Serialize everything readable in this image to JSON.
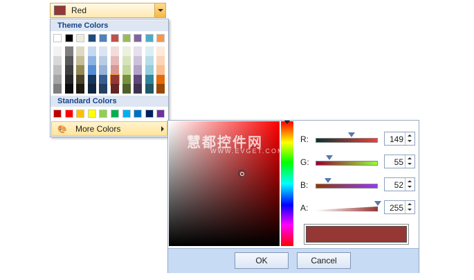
{
  "combo": {
    "selected_label": "Red",
    "selected_color": "#953734"
  },
  "palette": {
    "theme_title": "Theme Colors",
    "theme_top": [
      "#ffffff",
      "#000000",
      "#eeece1",
      "#1f497d",
      "#4f81bd",
      "#c0504d",
      "#9bbb59",
      "#8064a2",
      "#4bacc6",
      "#f79646"
    ],
    "theme_shades": [
      [
        "#f2f2f2",
        "#d8d8d8",
        "#bfbfbf",
        "#a5a5a5",
        "#7f7f7f"
      ],
      [
        "#7f7f7f",
        "#595959",
        "#3f3f3f",
        "#262626",
        "#0c0c0c"
      ],
      [
        "#ddd9c3",
        "#c4bd97",
        "#938953",
        "#494429",
        "#1d1b10"
      ],
      [
        "#c6d9f0",
        "#8db3e2",
        "#548dd4",
        "#17365d",
        "#0f243e"
      ],
      [
        "#dbe5f1",
        "#b8cce4",
        "#95b3d7",
        "#366092",
        "#244061"
      ],
      [
        "#f2dcdb",
        "#e5b9b7",
        "#d99694",
        "#953734",
        "#632423"
      ],
      [
        "#ebf1dd",
        "#d7e3bc",
        "#c3d69b",
        "#76923c",
        "#4f6128"
      ],
      [
        "#e5e0ec",
        "#ccc1d9",
        "#b2a2c7",
        "#5f497a",
        "#3f3151"
      ],
      [
        "#dbeef3",
        "#b7dde8",
        "#92cddc",
        "#31859b",
        "#205867"
      ],
      [
        "#fdeada",
        "#fbd5b5",
        "#fac08f",
        "#e36c09",
        "#974806"
      ]
    ],
    "selected_shade": {
      "column": 5,
      "row": 3
    },
    "standard_title": "Standard Colors",
    "standard": [
      "#c00000",
      "#ff0000",
      "#ffc000",
      "#ffff00",
      "#92d050",
      "#00b050",
      "#00b0f0",
      "#0070c0",
      "#002060",
      "#7030a0"
    ],
    "more_label": "More Colors"
  },
  "editor": {
    "watermark": "慧都控件网",
    "watermark_sub": "WWW.EVGET.COM",
    "channels": [
      {
        "key": "r",
        "label": "R:",
        "value": "149",
        "fraction": 0.58,
        "gradient": [
          "#003734",
          "#ff3734"
        ]
      },
      {
        "key": "g",
        "label": "G:",
        "value": "55",
        "fraction": 0.22,
        "gradient": [
          "#950034",
          "#95ff34"
        ]
      },
      {
        "key": "b",
        "label": "B:",
        "value": "52",
        "fraction": 0.2,
        "gradient": [
          "#953700",
          "#9537ff"
        ]
      },
      {
        "key": "a",
        "label": "A:",
        "value": "255",
        "fraction": 1.0,
        "gradient": [
          "#ffffff",
          "#953734"
        ]
      }
    ],
    "preview_color": "#953734",
    "ok_label": "OK",
    "cancel_label": "Cancel"
  }
}
